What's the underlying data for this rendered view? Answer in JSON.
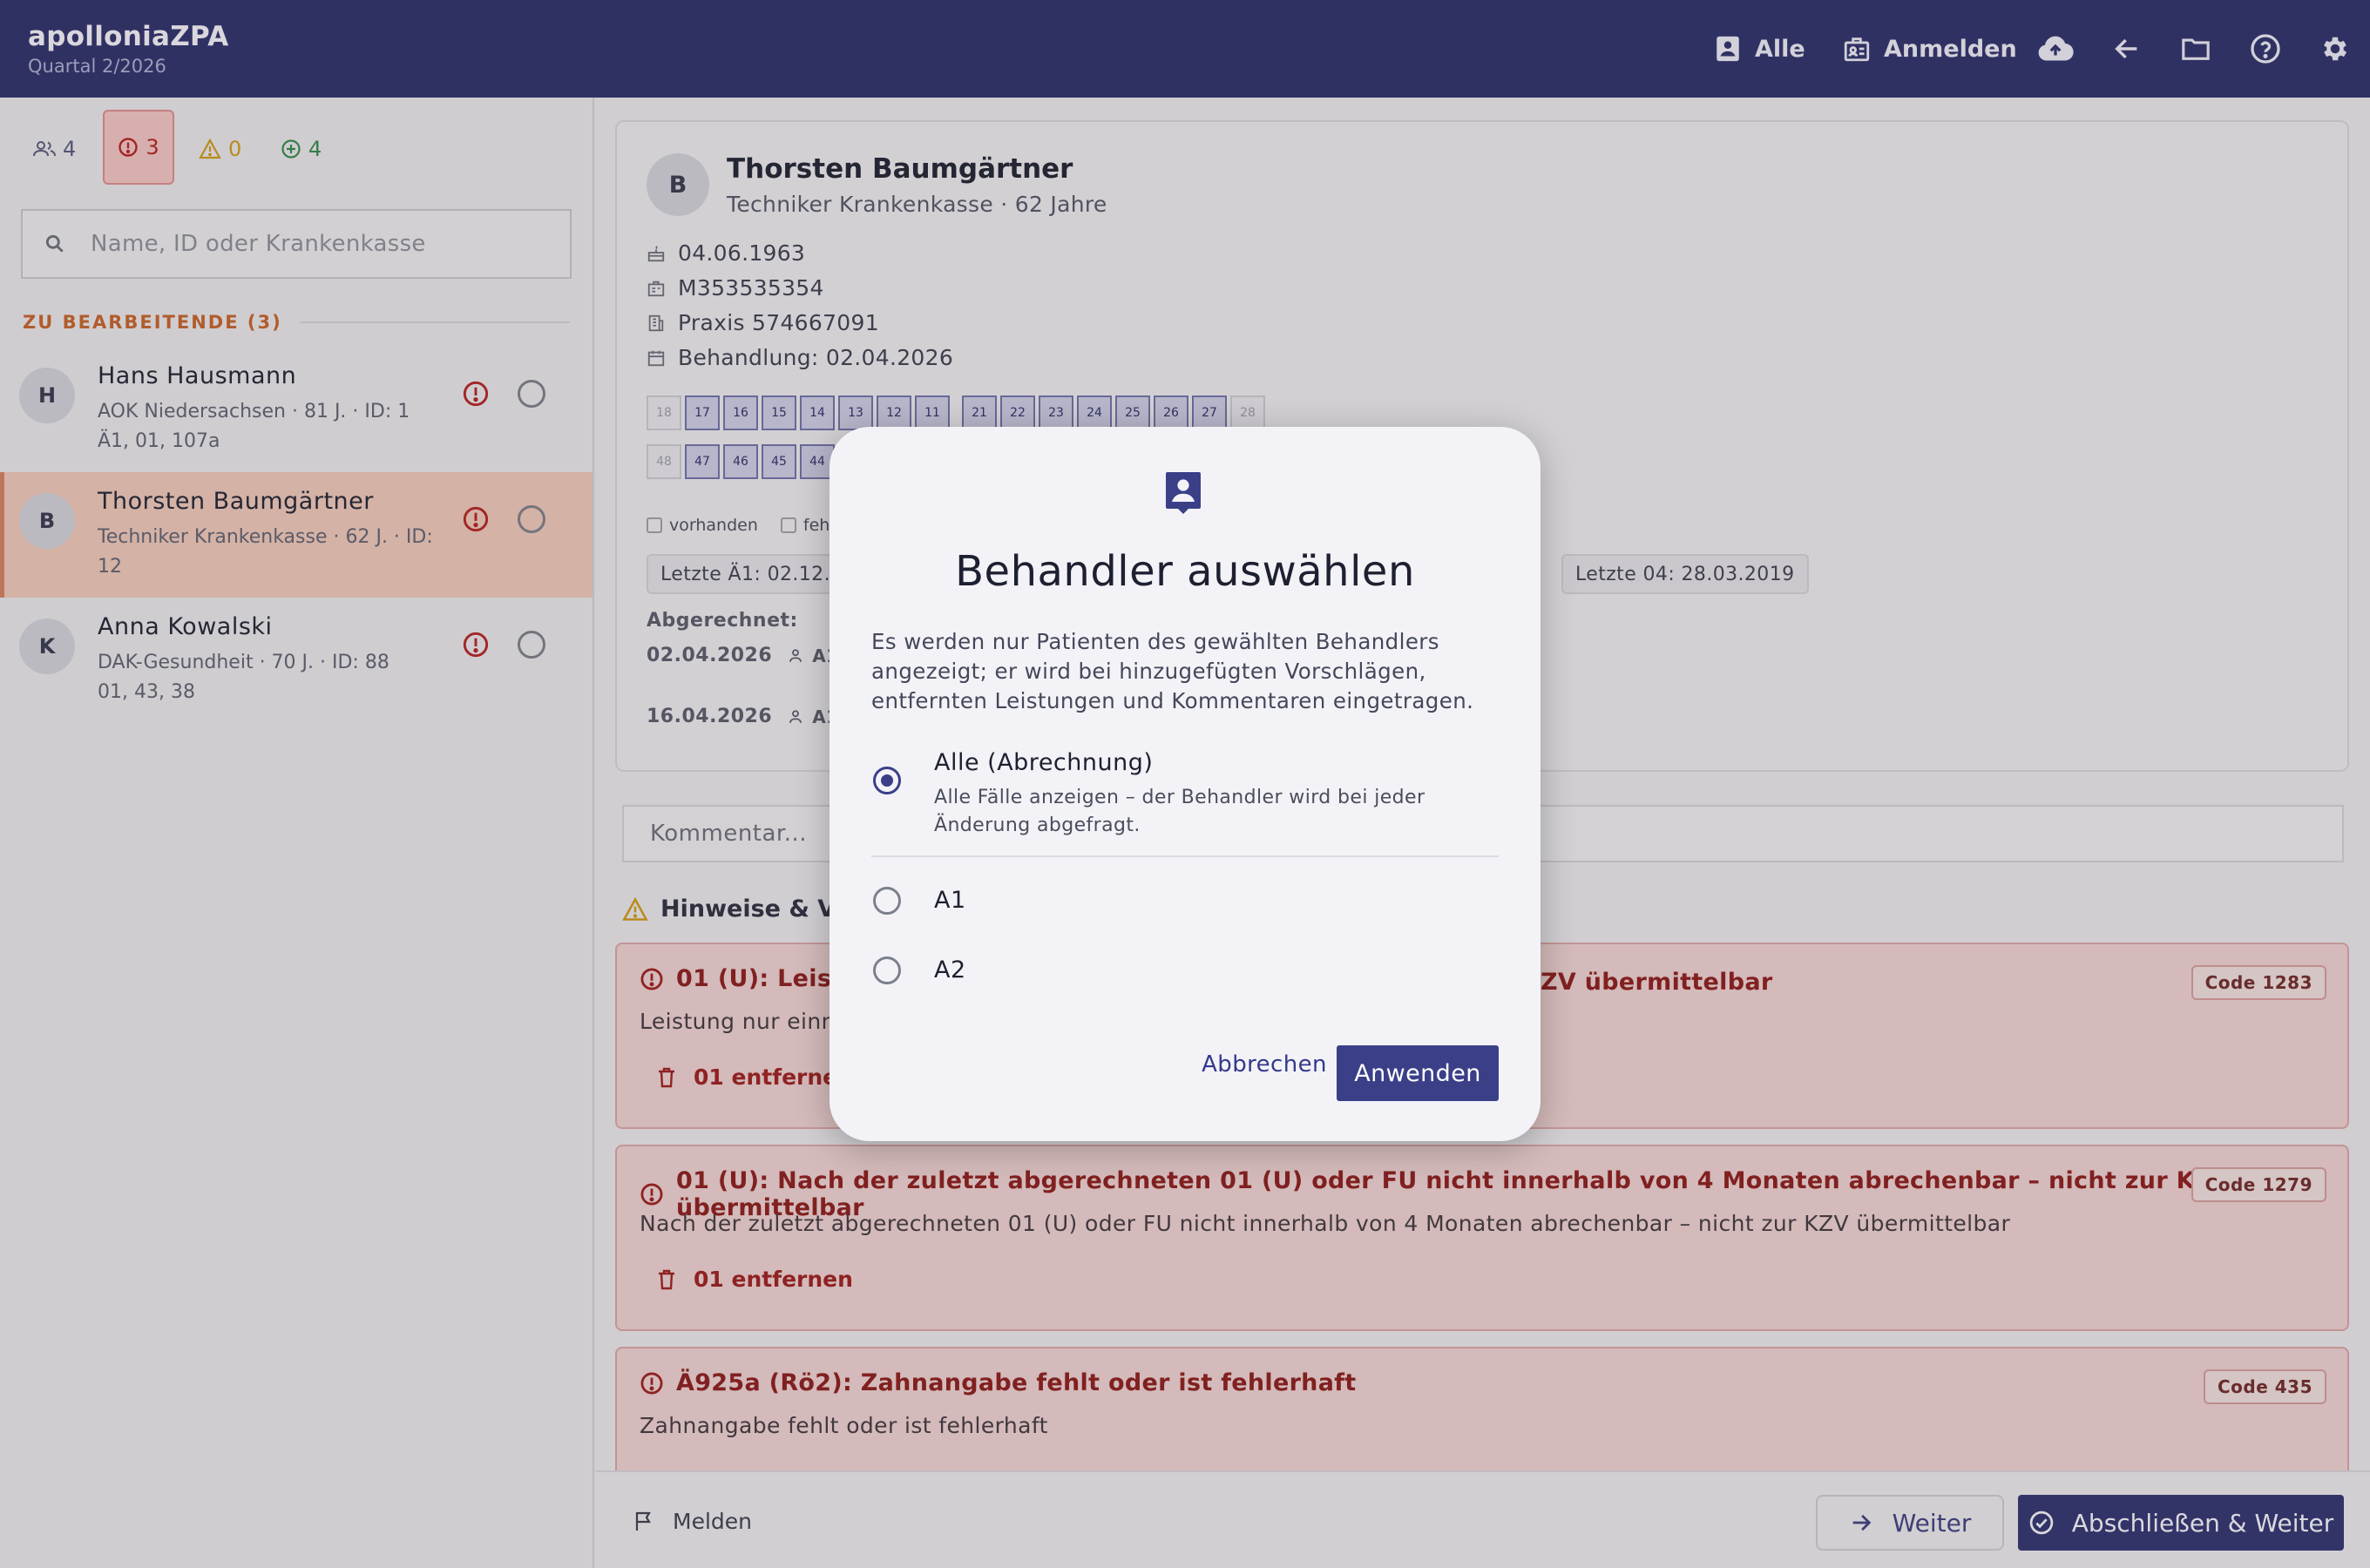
{
  "app": {
    "title": "apolloniaZPA",
    "quarter": "Quartal 2/2026"
  },
  "header": {
    "alle_label": "Alle",
    "anmelden_label": "Anmelden"
  },
  "sidebar": {
    "filters": [
      {
        "icon": "users-icon",
        "count": "4"
      },
      {
        "icon": "error-icon",
        "count": "3"
      },
      {
        "icon": "warning-icon",
        "count": "0"
      },
      {
        "icon": "plus-circle-icon",
        "count": "4"
      }
    ],
    "search_placeholder": "Name, ID oder Krankenkasse",
    "section_title": "ZU BEARBEITENDE (3)",
    "patients": [
      {
        "initial": "H",
        "name": "Hans Hausmann",
        "line1": "AOK Niedersachsen · 81 J. · ID: 1",
        "line2": "Ä1, 01, 107a"
      },
      {
        "initial": "B",
        "name": "Thorsten Baumgärtner",
        "line1": "Techniker Krankenkasse · 62 J. · ID:",
        "line2": "12"
      },
      {
        "initial": "K",
        "name": "Anna Kowalski",
        "line1": "DAK-Gesundheit · 70 J. · ID: 88",
        "line2": "01, 43, 38"
      }
    ]
  },
  "detail": {
    "initial": "B",
    "name": "Thorsten Baumgärtner",
    "subtitle": "Techniker Krankenkasse · 62 Jahre",
    "birthdate": "04.06.1963",
    "insurance_id": "M353535354",
    "practice": "Praxis 574667091",
    "treatment": "Behandlung: 02.04.2026",
    "teeth_upper": [
      "18",
      "17",
      "16",
      "15",
      "14",
      "13",
      "12",
      "11",
      "21",
      "22",
      "23",
      "24",
      "25",
      "26",
      "27",
      "28"
    ],
    "teeth_lower": [
      "48",
      "47",
      "46",
      "45",
      "44"
    ],
    "legend_present": "vorhanden",
    "legend_missing": "fehle",
    "chip_last_a1": "Letzte Ä1: 02.12.2",
    "chip_last_04": "Letzte 04: 28.03.2019",
    "billed_label": "Abgerechnet:",
    "billed": [
      {
        "date": "02.04.2026",
        "who": "A1"
      },
      {
        "date": "16.04.2026",
        "who": "A1"
      }
    ]
  },
  "comment_placeholder": "Kommentar...",
  "hints_title": "Hinweise & Ver",
  "issues": [
    {
      "title": "01 (U): Leistu",
      "title_tail": "ZV übermittelbar",
      "desc": "Leistung nur einma",
      "action": "01 entfernen",
      "code": "Code 1283"
    },
    {
      "title": "01 (U): Nach der zuletzt abgerechneten 01 (U) oder FU nicht innerhalb von 4 Monaten abrechenbar – nicht zur KZV übermittelbar",
      "desc": "Nach der zuletzt abgerechneten 01 (U) oder FU nicht innerhalb von 4 Monaten abrechenbar – nicht zur KZV übermittelbar",
      "action": "01 entfernen",
      "code": "Code 1279"
    },
    {
      "title": "Ä925a (Rö2): Zahnangabe fehlt oder ist fehlerhaft",
      "desc": "Zahnangabe fehlt oder ist fehlerhaft",
      "code": "Code 435"
    }
  ],
  "footer": {
    "melden": "Melden",
    "weiter": "Weiter",
    "abschliessen": "Abschließen & Weiter"
  },
  "dialog": {
    "title": "Behandler auswählen",
    "text": "Es werden nur Patienten des gewählten Behandlers angezeigt; er wird bei hinzugefügten Vorschlägen, entfernten Leistungen und Kommentaren eingetragen.",
    "options": [
      {
        "label": "Alle (Abrechnung)",
        "desc": "Alle Fälle anzeigen – der Behandler wird bei jeder Änderung abgefragt.",
        "selected": true
      },
      {
        "label": "A1",
        "selected": false
      },
      {
        "label": "A2",
        "selected": false
      }
    ],
    "cancel": "Abbrechen",
    "apply": "Anwenden"
  },
  "colors": {
    "header": "#2c306a",
    "accent": "#3a3f88",
    "error": "#9a1f1f",
    "warning": "#c99a1a",
    "success": "#2f8a4a"
  }
}
